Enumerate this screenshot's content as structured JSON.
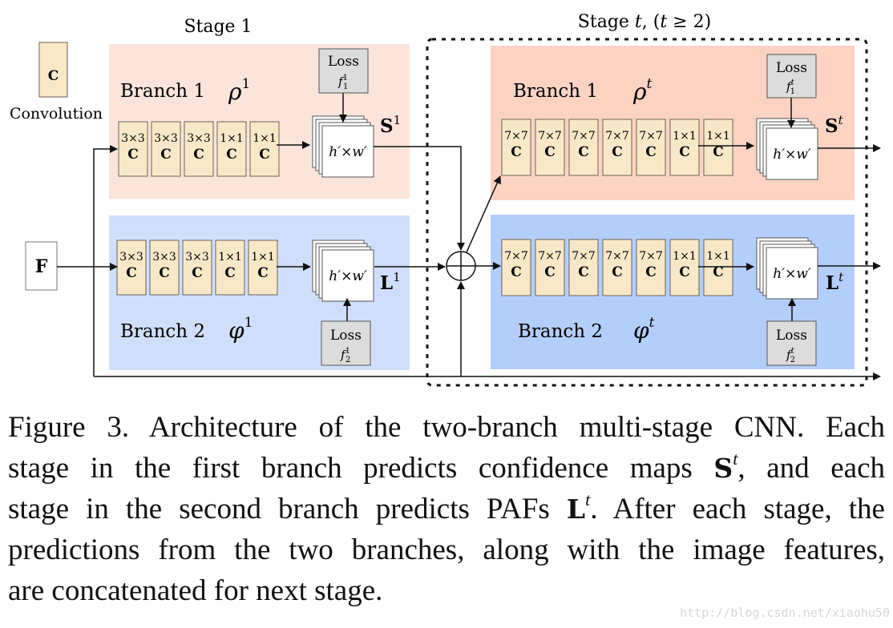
{
  "figure": {
    "legend": {
      "conv_symbol": "C",
      "conv_label": "Convolution"
    },
    "input": {
      "label": "F"
    },
    "stage1": {
      "title": "Stage 1",
      "branch1": {
        "label": "Branch 1",
        "symbol": "ρ",
        "sup": "1",
        "layers": [
          "3×3",
          "3×3",
          "3×3",
          "1×1",
          "1×1"
        ],
        "layer_symbol": "C",
        "output_map": "h′×w′",
        "output_label": "S",
        "output_sup": "1",
        "loss": {
          "label": "Loss",
          "f": "f",
          "sub": "1",
          "sup": "1"
        },
        "bg": "#fce4da"
      },
      "branch2": {
        "label": "Branch 2",
        "symbol": "φ",
        "sup": "1",
        "layers": [
          "3×3",
          "3×3",
          "3×3",
          "1×1",
          "1×1"
        ],
        "layer_symbol": "C",
        "output_map": "h′×w′",
        "output_label": "L",
        "output_sup": "1",
        "loss": {
          "label": "Loss",
          "f": "f",
          "sub": "2",
          "sup": "1"
        },
        "bg": "#cfdffb"
      }
    },
    "stageT": {
      "title_prefix": "Stage ",
      "title_var": "t",
      "title_suffix": ", (",
      "title_cond_var": "t",
      "title_cond": " ≥ 2)",
      "branch1": {
        "label": "Branch 1",
        "symbol": "ρ",
        "sup": "t",
        "layers": [
          "7×7",
          "7×7",
          "7×7",
          "7×7",
          "7×7",
          "1×1",
          "1×1"
        ],
        "layer_symbol": "C",
        "output_map": "h′×w′",
        "output_label": "S",
        "output_sup": "t",
        "loss": {
          "label": "Loss",
          "f": "f",
          "sub": "1",
          "sup": "t"
        },
        "bg": "#fad3c3"
      },
      "branch2": {
        "label": "Branch 2",
        "symbol": "φ",
        "sup": "t",
        "layers": [
          "7×7",
          "7×7",
          "7×7",
          "7×7",
          "7×7",
          "1×1",
          "1×1"
        ],
        "layer_symbol": "C",
        "output_map": "h′×w′",
        "output_label": "L",
        "output_sup": "t",
        "loss": {
          "label": "Loss",
          "f": "f",
          "sub": "2",
          "sup": "t"
        },
        "bg": "#b4cefa"
      }
    },
    "colors": {
      "conv_fill": "#f8e8c8",
      "conv_stroke": "#6b6355",
      "loss_fill": "#dcdcdc",
      "line": "#111111"
    }
  },
  "caption": {
    "lines": [
      [
        "Figure 3. Architecture of the two-branch multi-stage CNN. Each"
      ],
      [
        "stage in the first branch predicts confidence maps ",
        "S",
        "t",
        ", and each"
      ],
      [
        "stage in the second branch predicts PAFs ",
        "L",
        "t",
        ". After each stage, the"
      ],
      [
        "predictions from the two branches, along with the image features,"
      ],
      [
        "are concatenated for next stage."
      ]
    ]
  },
  "watermark": "http://blog.csdn.net/xiaohu50"
}
